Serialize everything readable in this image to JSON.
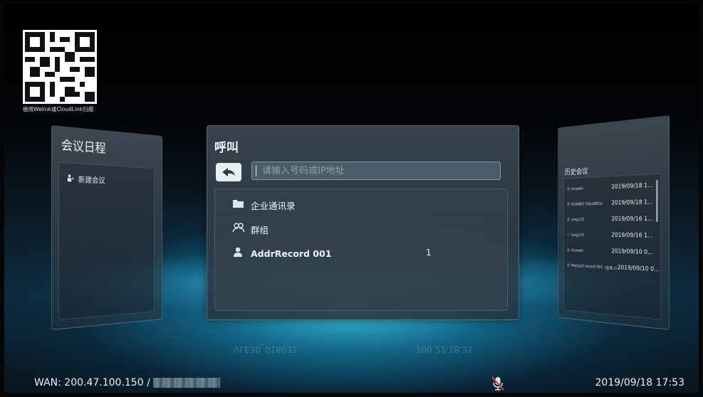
{
  "qr": {
    "caption": "使用Welink或CloudLink扫描"
  },
  "schedule": {
    "title": "会议日程",
    "new_meeting": "新建会议"
  },
  "call": {
    "title": "呼叫",
    "search_placeholder": "请输入号码或IP地址",
    "items": [
      {
        "label": "企业通讯录",
        "icon": "folder-icon"
      },
      {
        "label": "群组",
        "icon": "group-icon"
      },
      {
        "label": "AddrRecord 001",
        "icon": "person-icon",
        "count": "1"
      }
    ],
    "reflection_left": "VLE30_018031",
    "reflection_right": "200.22.18.31"
  },
  "history": {
    "title": "历史会议",
    "rows": [
      {
        "name": "Huawei",
        "date": "2019/09/18 1..."
      },
      {
        "name": "HUAWEI CloudMCU",
        "date": "2019/09/18 1..."
      },
      {
        "name": "sieg123",
        "date": "2019/09/16 1..."
      },
      {
        "name": "sieg123",
        "date": "2019/09/16 1..."
      },
      {
        "name": "Huawei",
        "date": "2019/09/10 0..."
      },
      {
        "name": "PreConf record 001",
        "extra": "(会场:1)",
        "date": "2019/09/10 0..."
      }
    ]
  },
  "status": {
    "wan_label": "WAN: 200.47.100.150 /",
    "datetime": "2019/09/18 17:53"
  },
  "colors": {
    "accent": "#3fc6e4",
    "panel": "#3a4a56",
    "text": "#e8eef2"
  }
}
